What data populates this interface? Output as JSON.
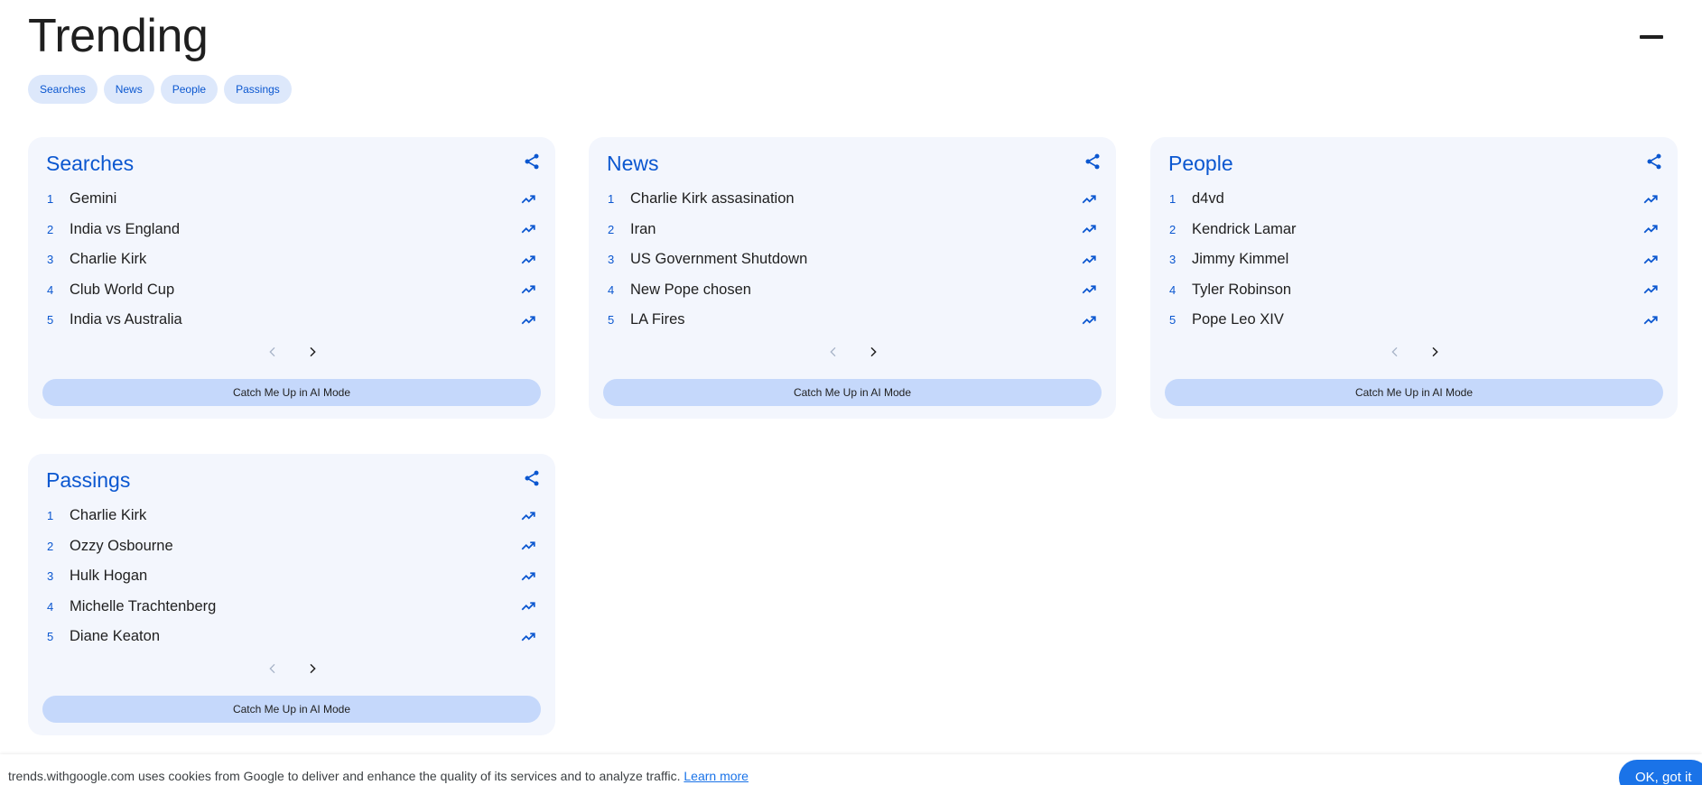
{
  "header": {
    "title": "Trending"
  },
  "chips": [
    "Searches",
    "News",
    "People",
    "Passings"
  ],
  "cards": [
    {
      "title": "Searches",
      "ai_label": "Catch Me Up in AI Mode",
      "items": [
        {
          "rank": "1",
          "term": "Gemini"
        },
        {
          "rank": "2",
          "term": "India vs England"
        },
        {
          "rank": "3",
          "term": "Charlie Kirk"
        },
        {
          "rank": "4",
          "term": "Club World Cup"
        },
        {
          "rank": "5",
          "term": "India vs Australia"
        }
      ]
    },
    {
      "title": "News",
      "ai_label": "Catch Me Up in AI Mode",
      "items": [
        {
          "rank": "1",
          "term": "Charlie Kirk assasination"
        },
        {
          "rank": "2",
          "term": "Iran"
        },
        {
          "rank": "3",
          "term": "US Government Shutdown"
        },
        {
          "rank": "4",
          "term": "New Pope chosen"
        },
        {
          "rank": "5",
          "term": "LA Fires"
        }
      ]
    },
    {
      "title": "People",
      "ai_label": "Catch Me Up in AI Mode",
      "items": [
        {
          "rank": "1",
          "term": "d4vd"
        },
        {
          "rank": "2",
          "term": "Kendrick Lamar"
        },
        {
          "rank": "3",
          "term": "Jimmy Kimmel"
        },
        {
          "rank": "4",
          "term": "Tyler Robinson"
        },
        {
          "rank": "5",
          "term": "Pope Leo XIV"
        }
      ]
    },
    {
      "title": "Passings",
      "ai_label": "Catch Me Up in AI Mode",
      "items": [
        {
          "rank": "1",
          "term": "Charlie Kirk"
        },
        {
          "rank": "2",
          "term": "Ozzy Osbourne"
        },
        {
          "rank": "3",
          "term": "Hulk Hogan"
        },
        {
          "rank": "4",
          "term": "Michelle Trachtenberg"
        },
        {
          "rank": "5",
          "term": "Diane Keaton"
        }
      ]
    }
  ],
  "cookie": {
    "text": "trends.withgoogle.com uses cookies from Google to deliver and enhance the quality of its services and to analyze traffic.",
    "link": "Learn more",
    "ok": "OK, got it"
  },
  "colors": {
    "accent": "#0b57d0",
    "card_bg": "#f3f6fd",
    "chip_bg": "#dde8fb",
    "ai_button_bg": "#c5d8fb",
    "ok_button_bg": "#1a73e8"
  },
  "icons": {
    "share": "share-icon",
    "trend": "trending-up-icon",
    "prev": "chevron-left-icon",
    "next": "chevron-right-icon",
    "collapse": "minus-icon"
  }
}
